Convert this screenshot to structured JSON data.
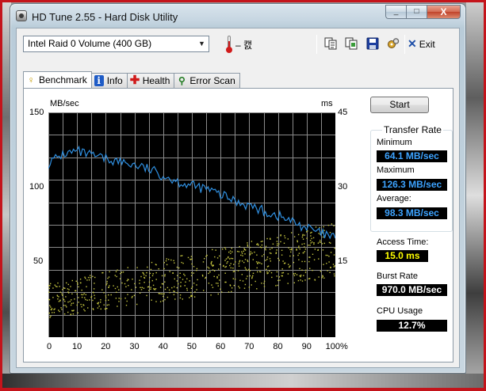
{
  "window": {
    "title": "HD Tune 2.55 - Hard Disk Utility",
    "buttons": {
      "minimize": "_",
      "maximize": "□",
      "close": "X"
    }
  },
  "toolbar": {
    "drive": "Intel   Raid 0 Volume (400 GB)",
    "temperature": "– 캜",
    "icons": [
      "copy-info-icon",
      "copy-screen-icon",
      "save-icon",
      "options-icon"
    ],
    "exit_label": "Exit"
  },
  "tabs": [
    {
      "label": "Benchmark",
      "icon": "benchmark-icon",
      "active": true
    },
    {
      "label": "Info",
      "icon": "info-icon",
      "active": false
    },
    {
      "label": "Health",
      "icon": "health-icon",
      "active": false
    },
    {
      "label": "Error Scan",
      "icon": "error-scan-icon",
      "active": false
    }
  ],
  "chart_data": {
    "type": "line",
    "y_left_label": "MB/sec",
    "y_right_label": "ms",
    "y_left_ticks": [
      "150",
      "100",
      "50"
    ],
    "y_right_ticks": [
      "45",
      "30",
      "15"
    ],
    "x_ticks": [
      "0",
      "10",
      "20",
      "30",
      "40",
      "50",
      "60",
      "70",
      "80",
      "90",
      "100%"
    ],
    "x_range": [
      0,
      100
    ],
    "y_left_range": [
      0,
      150
    ],
    "y_right_range": [
      0,
      45
    ],
    "grid": true,
    "background": "#000000",
    "series": [
      {
        "color": "#2f8fe0",
        "x": [
          0,
          5,
          10,
          15,
          20,
          25,
          30,
          35,
          40,
          45,
          50,
          55,
          60,
          65,
          70,
          75,
          80,
          85,
          90,
          95,
          100
        ],
        "values": [
          116,
          122,
          124,
          121,
          119,
          117,
          115,
          112,
          108,
          104,
          101,
          99,
          95,
          91,
          88,
          84,
          81,
          77,
          73,
          69,
          66
        ]
      }
    ],
    "access_scatter": {
      "color": "#c8c840",
      "x_range": [
        0,
        100
      ],
      "y_range_ms": [
        4,
        24
      ]
    }
  },
  "side": {
    "start_label": "Start",
    "transfer_rate_title": "Transfer Rate",
    "minimum_label": "Minimum",
    "minimum_value": "64.1 MB/sec",
    "maximum_label": "Maximum",
    "maximum_value": "126.3 MB/sec",
    "average_label": "Average:",
    "average_value": "98.3 MB/sec",
    "access_label": "Access Time:",
    "access_value": "15.0 ms",
    "burst_label": "Burst Rate",
    "burst_value": "970.0 MB/sec",
    "cpu_label": "CPU Usage",
    "cpu_value": "12.7%"
  }
}
